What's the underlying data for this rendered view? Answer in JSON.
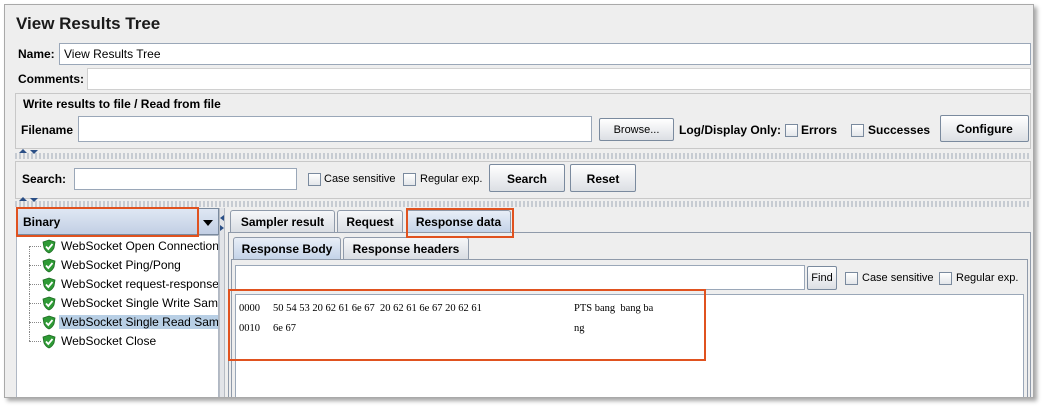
{
  "window": {
    "title": "View Results Tree"
  },
  "name_row": {
    "label": "Name:",
    "value": "View Results Tree"
  },
  "comments_row": {
    "label": "Comments:"
  },
  "file_group": {
    "legend": "Write results to file / Read from file",
    "filename_label": "Filename",
    "filename_value": "",
    "browse_label": "Browse...",
    "log_display_label": "Log/Display Only:",
    "errors_label": "Errors",
    "successes_label": "Successes",
    "configure_label": "Configure"
  },
  "search": {
    "label": "Search:",
    "value": "",
    "case_sensitive_label": "Case sensitive",
    "regex_label": "Regular exp.",
    "search_button": "Search",
    "reset_button": "Reset"
  },
  "renderer": {
    "selected": "Binary"
  },
  "tree": {
    "items": [
      {
        "label": "WebSocket Open Connection",
        "selected": false
      },
      {
        "label": "WebSocket Ping/Pong",
        "selected": false
      },
      {
        "label": "WebSocket request-response",
        "selected": false
      },
      {
        "label": "WebSocket Single Write Sampler",
        "selected": false
      },
      {
        "label": "WebSocket Single Read Sampler",
        "selected": true
      },
      {
        "label": "WebSocket Close",
        "selected": false
      }
    ]
  },
  "tabs": {
    "main": [
      "Sampler result",
      "Request",
      "Response data"
    ],
    "active_main": "Response data",
    "sub": [
      "Response Body",
      "Response headers"
    ],
    "active_sub": "Response Body"
  },
  "response_search": {
    "value": "",
    "find_button": "Find",
    "case_sensitive_label": "Case sensitive",
    "regex_label": "Regular exp."
  },
  "hex_dump": {
    "rows": [
      {
        "offset": "0000",
        "hex": "50 54 53 20 62 61 6e 67  20 62 61 6e 67 20 62 61",
        "ascii": "PTS bang  bang ba"
      },
      {
        "offset": "0010",
        "hex": "6e 67",
        "ascii": "ng"
      }
    ]
  },
  "colors": {
    "highlight": "#e0521f",
    "selection": "#b8cfe5",
    "shield_green": "#2e9a35"
  }
}
